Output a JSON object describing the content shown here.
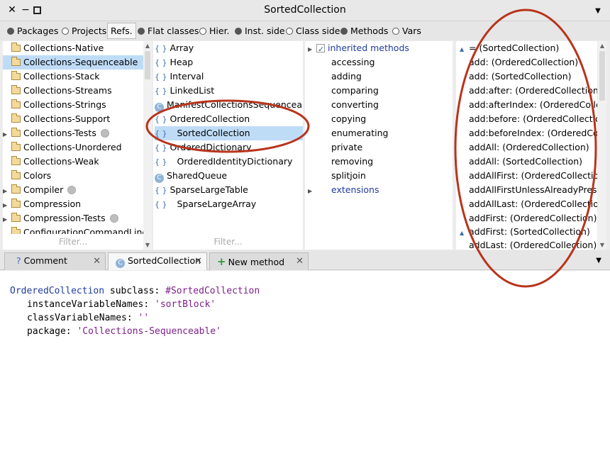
{
  "window": {
    "title": "SortedCollection"
  },
  "toolbar": {
    "packages": "Packages",
    "projects": "Projects",
    "refs": "Refs.",
    "flat_classes": "Flat classes",
    "hier": "Hier.",
    "inst_side": "Inst. side",
    "class_side": "Class side",
    "methods": "Methods",
    "vars": "Vars"
  },
  "packages": [
    {
      "label": "Collections-Native",
      "expand": false,
      "badge": false
    },
    {
      "label": "Collections-Sequenceable",
      "expand": false,
      "badge": false,
      "selected": true
    },
    {
      "label": "Collections-Stack",
      "expand": false,
      "badge": false
    },
    {
      "label": "Collections-Streams",
      "expand": false,
      "badge": false
    },
    {
      "label": "Collections-Strings",
      "expand": false,
      "badge": false
    },
    {
      "label": "Collections-Support",
      "expand": false,
      "badge": false
    },
    {
      "label": "Collections-Tests",
      "expand": true,
      "badge": true
    },
    {
      "label": "Collections-Unordered",
      "expand": false,
      "badge": false
    },
    {
      "label": "Collections-Weak",
      "expand": false,
      "badge": false
    },
    {
      "label": "Colors",
      "expand": false,
      "badge": false
    },
    {
      "label": "Compiler",
      "expand": true,
      "badge": true
    },
    {
      "label": "Compression",
      "expand": true,
      "badge": false
    },
    {
      "label": "Compression-Tests",
      "expand": true,
      "badge": true
    },
    {
      "label": "ConfigurationCommandLinek",
      "expand": false,
      "badge": false
    }
  ],
  "classes": [
    {
      "label": "Array",
      "icon": "braces",
      "indent": 0
    },
    {
      "label": "Heap",
      "icon": "braces",
      "indent": 0
    },
    {
      "label": "Interval",
      "icon": "braces",
      "indent": 0
    },
    {
      "label": "LinkedList",
      "icon": "braces",
      "indent": 0
    },
    {
      "label": "ManifestCollectionsSequenceable",
      "icon": "class",
      "indent": 0
    },
    {
      "label": "OrderedCollection",
      "icon": "braces",
      "indent": 0
    },
    {
      "label": "SortedCollection",
      "icon": "braces",
      "indent": 1,
      "selected": true
    },
    {
      "label": "OrderedDictionary",
      "icon": "braces",
      "indent": 0
    },
    {
      "label": "OrderedIdentityDictionary",
      "icon": "braces",
      "indent": 1
    },
    {
      "label": "SharedQueue",
      "icon": "class",
      "indent": 0
    },
    {
      "label": "SparseLargeTable",
      "icon": "braces",
      "indent": 0
    },
    {
      "label": "SparseLargeArray",
      "icon": "braces",
      "indent": 1
    }
  ],
  "protocols": {
    "inherited": "inherited methods",
    "items": [
      "accessing",
      "adding",
      "comparing",
      "converting",
      "copying",
      "enumerating",
      "private",
      "removing",
      "splitjoin"
    ],
    "extensions": "extensions"
  },
  "methods": [
    {
      "label": "= (SortedCollection)",
      "marker": true
    },
    {
      "label": "add: (OrderedCollection)"
    },
    {
      "label": "add: (SortedCollection)"
    },
    {
      "label": "add:after: (OrderedCollection)"
    },
    {
      "label": "add:afterIndex: (OrderedCollection"
    },
    {
      "label": "add:before: (OrderedCollection)"
    },
    {
      "label": "add:beforeIndex: (OrderedCollect"
    },
    {
      "label": "addAll: (OrderedCollection)"
    },
    {
      "label": "addAll: (SortedCollection)"
    },
    {
      "label": "addAllFirst: (OrderedCollection)"
    },
    {
      "label": "addAllFirstUnlessAlreadyPresent:"
    },
    {
      "label": "addAllLast: (OrderedCollection)"
    },
    {
      "label": "addFirst: (OrderedCollection)"
    },
    {
      "label": "addFirst: (SortedCollection)",
      "marker": true
    },
    {
      "label": "addLast: (OrderedCollection)"
    }
  ],
  "filter_placeholder": "Filter...",
  "tabs": [
    {
      "label": "Comment"
    },
    {
      "label": "SortedCollection"
    },
    {
      "label": "New method"
    }
  ],
  "code": {
    "l1_super": "OrderedCollection",
    "l1_msg": " subclass: ",
    "l1_sym": "#SortedCollection",
    "l2_kw": "instanceVariableNames: ",
    "l2_str": "'sortBlock'",
    "l3_kw": "classVariableNames: ",
    "l3_str": "''",
    "l4_kw": "package: ",
    "l4_str": "'Collections-Sequenceable'"
  },
  "colors": {
    "selection": "#bfdcf7",
    "annotation": "#b8341c",
    "code_blue": "#1f3b9e",
    "code_purple": "#7d1f8a"
  }
}
